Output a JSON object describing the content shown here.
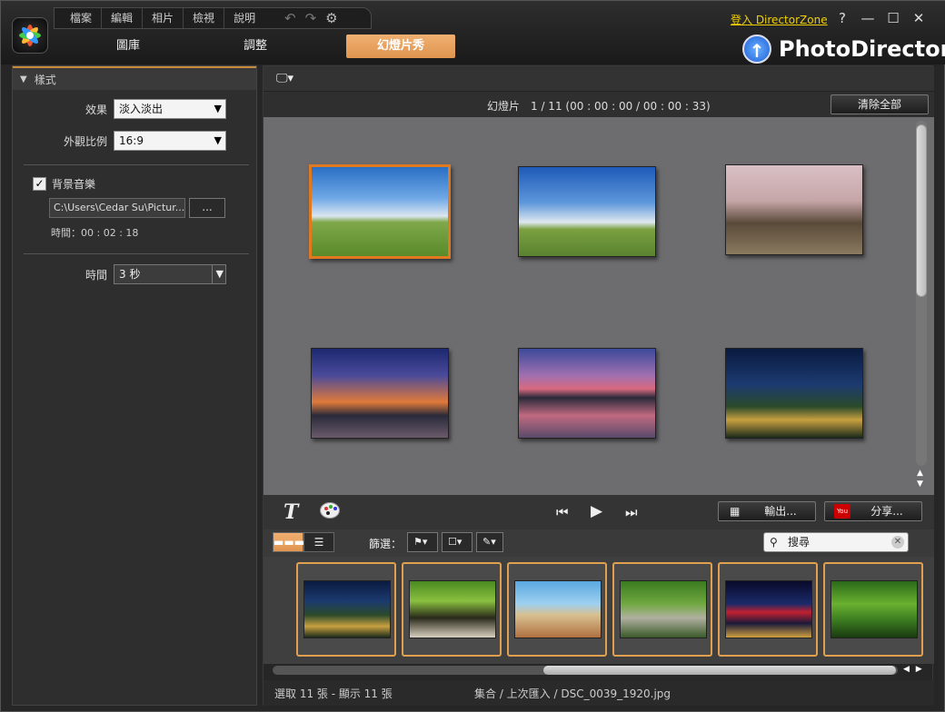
{
  "menu": [
    "檔案",
    "編輯",
    "相片",
    "檢視",
    "說明"
  ],
  "tabs": [
    {
      "label": "圖庫",
      "active": false
    },
    {
      "label": "調整",
      "active": false
    },
    {
      "label": "幻燈片秀",
      "active": true
    }
  ],
  "header": {
    "login_link": "登入 DirectorZone",
    "brand": "PhotoDirector",
    "help": "?",
    "minimize": "—",
    "maximize": "☐",
    "close": "✕"
  },
  "left_panel": {
    "section_title": "樣式",
    "effect_label": "效果",
    "effect_value": "淡入淡出",
    "aspect_label": "外觀比例",
    "aspect_value": "16:9",
    "bg_music_label": "背景音樂",
    "bg_music_checked": true,
    "music_path": "C:\\Users\\Cedar Su\\Pictur...",
    "browse_label": "...",
    "music_time": "時間：00 : 02 : 18",
    "duration_label": "時間",
    "duration_value": "3 秒"
  },
  "slideshow": {
    "counter_text": "幻燈片　1 /  11 (00 : 00 : 00 / 00 : 00 : 33)",
    "clear_all": "清除全部",
    "output_label": "輸出...",
    "share_label": "分享...",
    "text_tool": "T"
  },
  "filter": {
    "label": "篩選：",
    "search_placeholder": "搜尋"
  },
  "status": {
    "selection": "選取 11 張 - 顯示 11 張",
    "path": "集合 / 上次匯入 / DSC_0039_1920.jpg"
  },
  "colors": {
    "accent": "#e09550",
    "login": "#f0d000"
  }
}
